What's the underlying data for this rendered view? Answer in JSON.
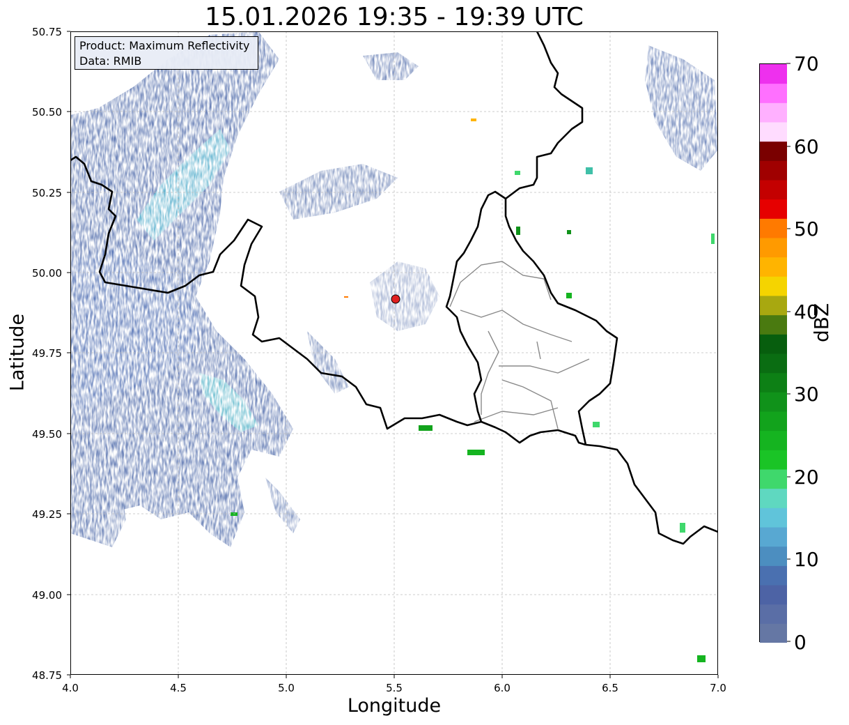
{
  "title": "15.01.2026 19:35 - 19:39 UTC",
  "xlabel": "Longitude",
  "ylabel": "Latitude",
  "xticks": [
    "4.0",
    "4.5",
    "5.0",
    "5.5",
    "6.0",
    "6.5",
    "7.0"
  ],
  "yticks": [
    "50.75",
    "50.50",
    "50.25",
    "50.00",
    "49.75",
    "49.50",
    "49.25",
    "49.00",
    "48.75"
  ],
  "xlim": [
    4.0,
    7.0
  ],
  "ylim": [
    48.75,
    50.75
  ],
  "info": {
    "line1": "Product: Maximum Reflectivity",
    "line2": "Data: RMIB"
  },
  "radar_site": {
    "lon": 5.505,
    "lat": 49.915,
    "color": "#e02020"
  },
  "colorbar": {
    "label": "dBZ",
    "min": 0,
    "max": 70,
    "ticks": [
      "0",
      "10",
      "20",
      "30",
      "40",
      "50",
      "60",
      "70"
    ],
    "colors": [
      "#6577a4",
      "#5a6ea6",
      "#4d63a5",
      "#4a70b0",
      "#4c8ec0",
      "#58a8d2",
      "#60c4da",
      "#5fd8c0",
      "#3fd86c",
      "#1ac426",
      "#15b420",
      "#12a31c",
      "#10921a",
      "#0d8015",
      "#0a6d12",
      "#075e0e",
      "#4a7a10",
      "#a8a810",
      "#f5d400",
      "#ffb400",
      "#ff9a00",
      "#ff7a00",
      "#e60000",
      "#c40000",
      "#a00000",
      "#7a0000",
      "#ffdcff",
      "#ffb0ff",
      "#ff70ff",
      "#ee30ee"
    ]
  },
  "layers": {
    "reflectivity": "Maximum reflectivity echoes (blue/cyan band west, scattered green cells east)",
    "borders": "country borders",
    "provinces": "province boundaries"
  }
}
